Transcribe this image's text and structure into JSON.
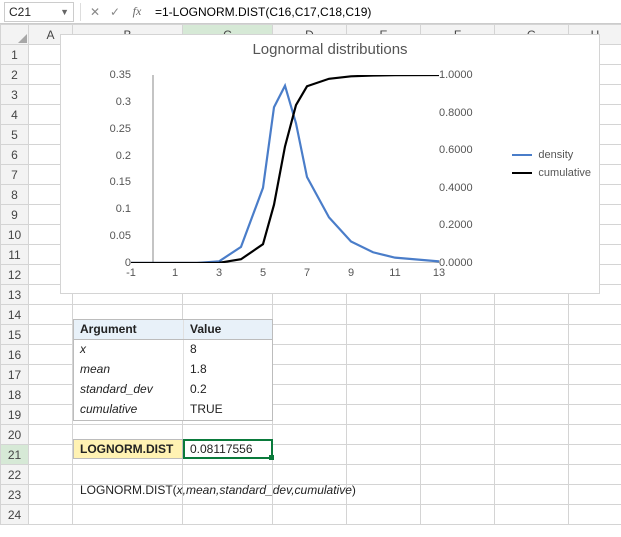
{
  "formula_bar": {
    "cell_ref": "C21",
    "formula": "=1-LOGNORM.DIST(C16,C17,C18,C19)"
  },
  "columns": [
    "A",
    "B",
    "C",
    "D",
    "E",
    "F",
    "G",
    "H"
  ],
  "row_count": 24,
  "chart_data": {
    "type": "line",
    "title": "Lognormal distributions",
    "x": [
      -1,
      0,
      1,
      2,
      3,
      4,
      5,
      6,
      7,
      8,
      9,
      10,
      11,
      12,
      13
    ],
    "xlim": [
      -1,
      13
    ],
    "x_ticks": [
      -1,
      1,
      3,
      5,
      7,
      9,
      11,
      13
    ],
    "y1lim": [
      0,
      0.35
    ],
    "y1_ticks": [
      0,
      0.05,
      0.1,
      0.15,
      0.2,
      0.25,
      0.3,
      0.35
    ],
    "y2lim": [
      0,
      1
    ],
    "y2_ticks": [
      0.0,
      0.2,
      0.4,
      0.6,
      0.8,
      1.0
    ],
    "series": [
      {
        "name": "density",
        "axis": "left",
        "color": "#4a7dc9",
        "values": [
          0,
          0,
          0,
          0,
          0.003,
          0.03,
          0.14,
          0.29,
          0.33,
          0.26,
          0.16,
          0.085,
          0.04,
          0.02,
          0.01,
          0.003
        ]
      },
      {
        "name": "cumulative",
        "axis": "right",
        "color": "#000000",
        "values": [
          0,
          0,
          0,
          0,
          0.001,
          0.02,
          0.1,
          0.31,
          0.62,
          0.84,
          0.94,
          0.98,
          0.993,
          0.997,
          0.999,
          1.0
        ]
      }
    ]
  },
  "args_table": {
    "header": {
      "col1": "Argument",
      "col2": "Value"
    },
    "rows": [
      {
        "name": "x",
        "value": "8"
      },
      {
        "name": "mean",
        "value": "1.8"
      },
      {
        "name": "standard_dev",
        "value": "0.2"
      },
      {
        "name": "cumulative",
        "value": "TRUE"
      }
    ]
  },
  "result": {
    "label": "LOGNORM.DIST",
    "value": "0.08117556"
  },
  "usage": {
    "fn": "LOGNORM.DIST(",
    "args": "x,mean,standard_dev,cumulative",
    "close": ")"
  }
}
